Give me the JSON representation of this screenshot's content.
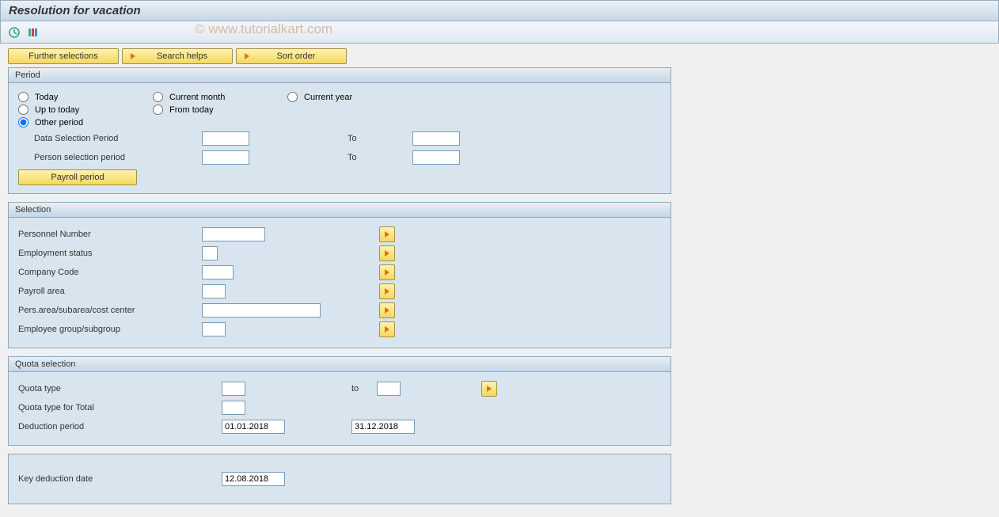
{
  "title": "Resolution for vacation",
  "watermark": "© www.tutorialkart.com",
  "toolbar_buttons": {
    "further_selections": "Further selections",
    "search_helps": "Search helps",
    "sort_order": "Sort order"
  },
  "period": {
    "title": "Period",
    "radios": {
      "today": "Today",
      "current_month": "Current month",
      "current_year": "Current year",
      "up_to_today": "Up to today",
      "from_today": "From today",
      "other_period": "Other period"
    },
    "data_selection_label": "Data Selection Period",
    "data_selection_from": "",
    "data_selection_to": "",
    "person_selection_label": "Person selection period",
    "person_selection_from": "",
    "person_selection_to": "",
    "to_label": "To",
    "payroll_button": "Payroll period"
  },
  "selection": {
    "title": "Selection",
    "personnel_number": {
      "label": "Personnel Number",
      "value": ""
    },
    "employment_status": {
      "label": "Employment status",
      "value": ""
    },
    "company_code": {
      "label": "Company Code",
      "value": ""
    },
    "payroll_area": {
      "label": "Payroll area",
      "value": ""
    },
    "pers_area": {
      "label": "Pers.area/subarea/cost center",
      "value": ""
    },
    "emp_group": {
      "label": "Employee group/subgroup",
      "value": ""
    }
  },
  "quota": {
    "title": "Quota selection",
    "quota_type": {
      "label": "Quota type",
      "value": "",
      "to_label": "to",
      "to_value": ""
    },
    "quota_type_total": {
      "label": "Quota type for Total",
      "value": ""
    },
    "deduction_period": {
      "label": "Deduction period",
      "from": "01.01.2018",
      "to": "31.12.2018"
    }
  },
  "key_deduction": {
    "label": "Key deduction date",
    "value": "12.08.2018"
  }
}
